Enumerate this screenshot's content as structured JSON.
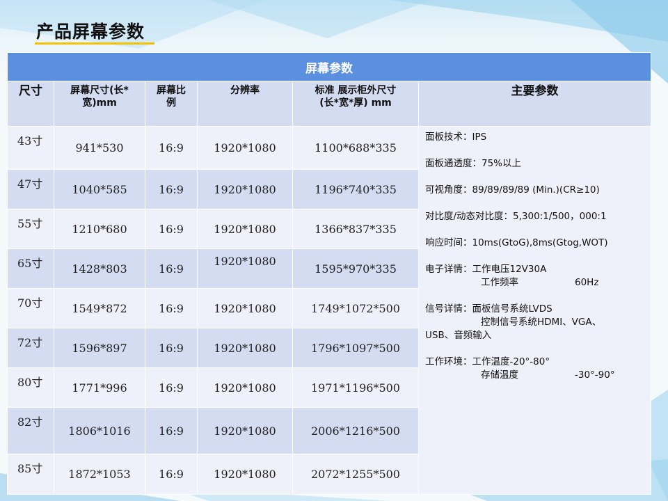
{
  "title": "产品屏幕参数",
  "table": {
    "caption": "屏幕参数",
    "headers": {
      "size": "尺寸",
      "screen_size": [
        "屏幕尺寸(长*",
        "宽)mm"
      ],
      "ratio": [
        "屏幕比",
        "例"
      ],
      "resolution": "分辨率",
      "cabinet": [
        "标准 展示柜外尺寸",
        "(长*宽*厚)  mm"
      ],
      "params": "主要参数"
    },
    "rows": [
      {
        "size": "43寸",
        "screen": "941*530",
        "ratio": "16:9",
        "res": "1920*1080",
        "cabinet": "1100*688*335"
      },
      {
        "size": "47寸",
        "screen": "1040*585",
        "ratio": "16:9",
        "res": "1920*1080",
        "cabinet": "1196*740*335"
      },
      {
        "size": "55寸",
        "screen": "1210*680",
        "ratio": "16:9",
        "res": "1920*1080",
        "cabinet": "1366*837*335"
      },
      {
        "size": "65寸",
        "screen": "1428*803",
        "ratio": "16:9",
        "res": "1920*1080",
        "cabinet": "1595*970*335"
      },
      {
        "size": "70寸",
        "screen": "1549*872",
        "ratio": "16:9",
        "res": "1920*1080",
        "cabinet": "1749*1072*500"
      },
      {
        "size": "72寸",
        "screen": "1596*897",
        "ratio": "16:9",
        "res": "1920*1080",
        "cabinet": "1796*1097*500"
      },
      {
        "size": "80寸",
        "screen": "1771*996",
        "ratio": "16:9",
        "res": "1920*1080",
        "cabinet": "1971*1196*500"
      },
      {
        "size": "82寸",
        "screen": "1806*1016",
        "ratio": "16:9",
        "res": "1920*1080",
        "cabinet": "2006*1216*500"
      },
      {
        "size": "85寸",
        "screen": "1872*1053",
        "ratio": "16:9",
        "res": "1920*1080",
        "cabinet": "2072*1255*500"
      }
    ],
    "params": {
      "panel_tech": "面板技术：IPS",
      "transmittance": "面板通透度：75%以上",
      "viewing_angle": "可视角度：89/89/89/89 (Min.)(CR≥10)",
      "contrast": "对比度/动态对比度：5,300:1/500，000:1",
      "response": "响应时间：10ms(GtoG),8ms(Gtog,WOT)",
      "electronics_label": "电子详情：工作电压12V30A",
      "frequency_label": "工作频率",
      "frequency_value": "60Hz",
      "signal_label": "信号详情：面板信号系统LVDS",
      "control_signal": "控制信号系统HDMI、VGA、",
      "usb": "USB、音频输入",
      "environment_label": "工作环境：工作温度-20°-80°",
      "storage_label": "存储温度",
      "storage_value": "-30°-90°"
    }
  },
  "colors": {
    "caption_bg": "#5b8fe0",
    "header_bg": "#d4dcf2",
    "row_light": "#eef1f9",
    "accent_underline": "#f2c200"
  }
}
